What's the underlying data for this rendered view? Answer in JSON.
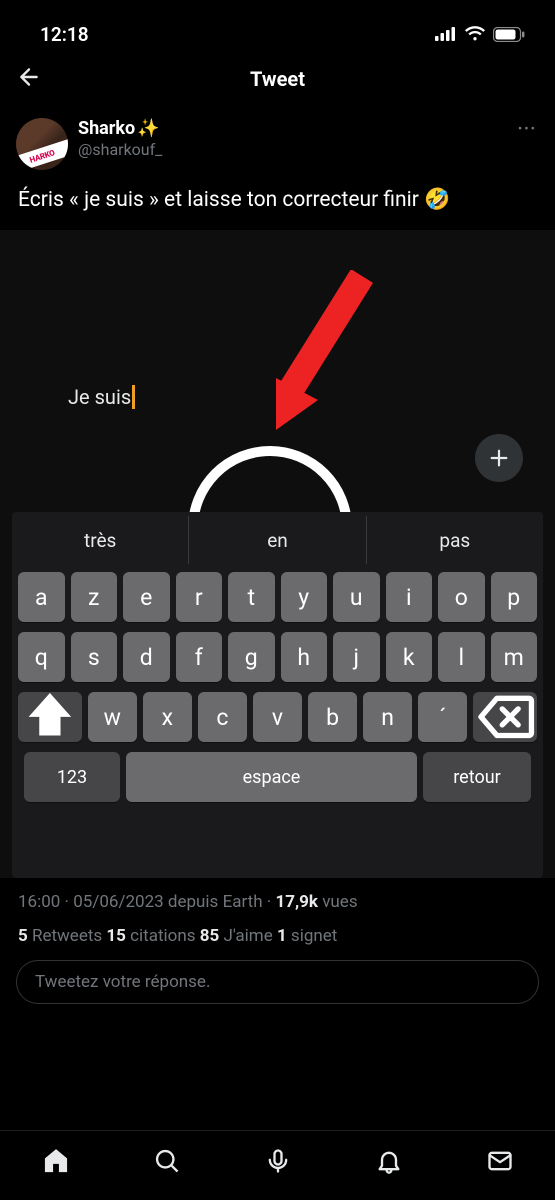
{
  "status": {
    "time": "12:18"
  },
  "header": {
    "title": "Tweet"
  },
  "tweet": {
    "display_name": "Sharko",
    "sparkles": "✨",
    "handle": "@sharkouf_",
    "avatar_band": "HARKO",
    "text": "Écris « je suis » et laisse ton correcteur finir 🤣"
  },
  "embed": {
    "compose_text": "Je suis",
    "suggestions": [
      "très",
      "en",
      "pas"
    ],
    "keyboard": {
      "row1": [
        "a",
        "z",
        "e",
        "r",
        "t",
        "y",
        "u",
        "i",
        "o",
        "p"
      ],
      "row2": [
        "q",
        "s",
        "d",
        "f",
        "g",
        "h",
        "j",
        "k",
        "l",
        "m"
      ],
      "row3": [
        "w",
        "x",
        "c",
        "v",
        "b",
        "n",
        "´"
      ],
      "num_key": "123",
      "space": "espace",
      "return": "retour"
    }
  },
  "meta": {
    "time": "16:00",
    "sep1": " · ",
    "date": "05/06/2023",
    "from_label": " depuis ",
    "source": "Earth",
    "sep2": " · ",
    "views_count": "17,9k",
    "views_label": " vues"
  },
  "stats": {
    "retweets_count": "5",
    "retweets_label": " Retweets  ",
    "quotes_count": "15",
    "quotes_label": " citations  ",
    "likes_count": "85",
    "likes_label": " J'aime  ",
    "bookmarks_count": "1",
    "bookmarks_label": " signet"
  },
  "reply": {
    "placeholder": "Tweetez votre réponse."
  }
}
